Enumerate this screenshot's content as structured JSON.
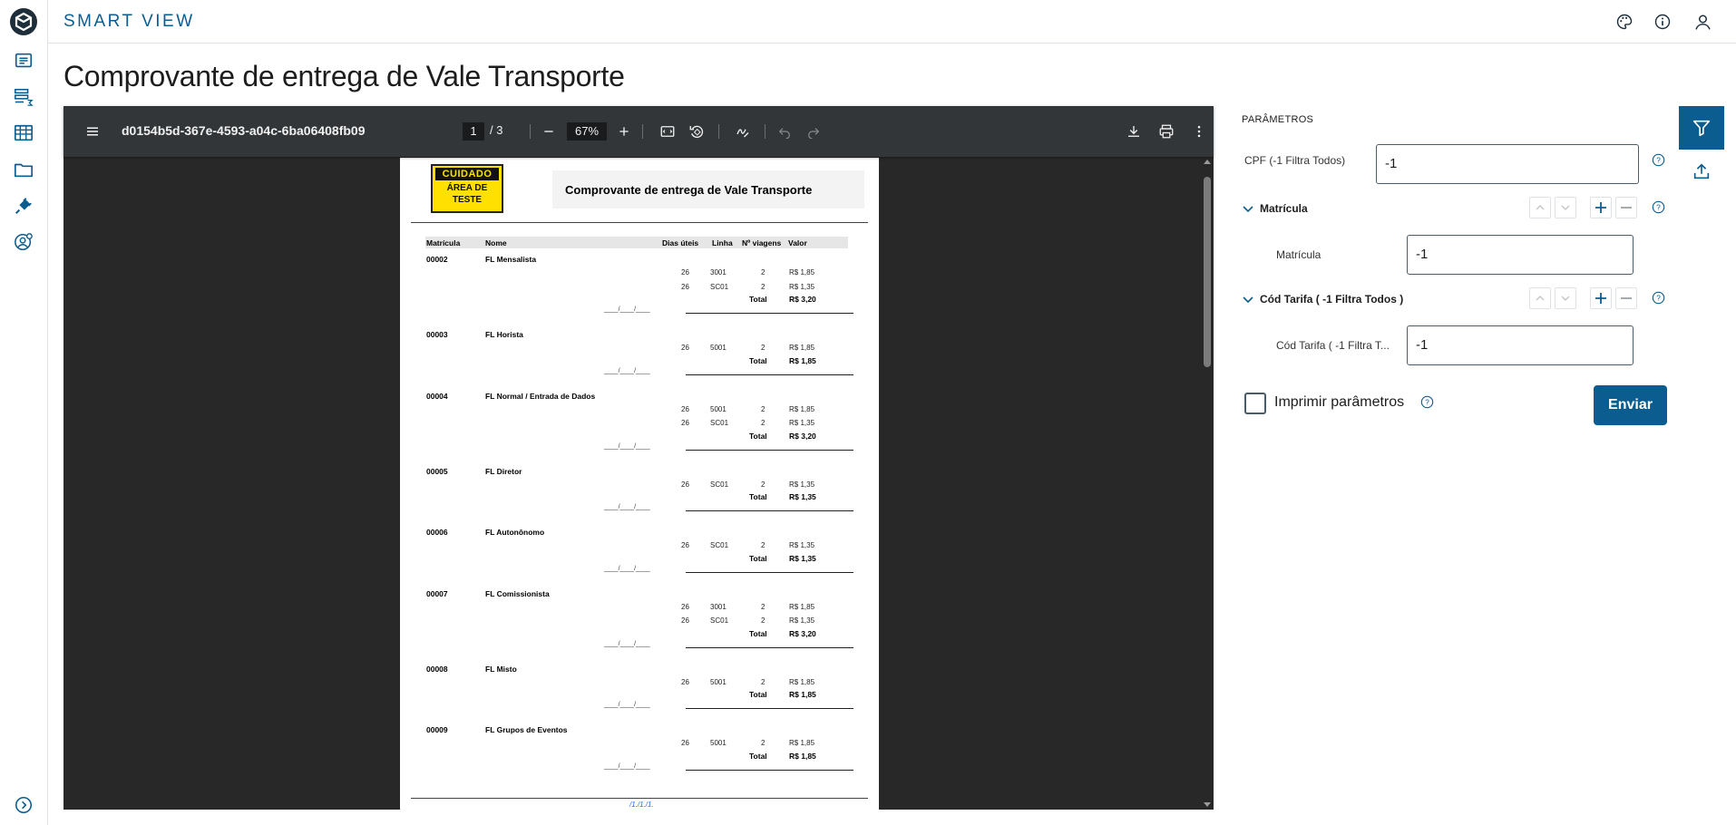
{
  "app": {
    "brand": "SMART VIEW"
  },
  "colors": {
    "accent": "#0c5d8f",
    "viewer_bg": "#282828",
    "toolbar_bg": "#323639",
    "warning_yellow": "#ffe000"
  },
  "sidebar": {
    "items": [
      {
        "icon": "report-icon"
      },
      {
        "icon": "data-table-sum-icon"
      },
      {
        "icon": "grid-table-icon"
      },
      {
        "icon": "folder-icon"
      },
      {
        "icon": "plug-icon"
      },
      {
        "icon": "user-settings-icon"
      }
    ],
    "expand_icon": "chevron-right-circle-icon"
  },
  "header": {
    "icons": [
      "palette-icon",
      "info-icon",
      "user-icon"
    ]
  },
  "page": {
    "title": "Comprovante de entrega de Vale Transporte"
  },
  "viewer": {
    "doc_name": "d0154b5d-367e-4593-a04c-6ba06408fb09",
    "current_page": "1",
    "page_sep": "/ 3",
    "zoom": "67%"
  },
  "report": {
    "warning_line1": "CUIDADO",
    "warning_line2": "ÁREA DE",
    "warning_line3": "TESTE",
    "title": "Comprovante de entrega de Vale Transporte",
    "headers": {
      "matricula": "Matrícula",
      "nome": "Nome",
      "dias": "Dias úteis",
      "linha": "Linha",
      "viagens": "Nº viagens",
      "valor": "Valor"
    },
    "sig_placeholder": "____/____/____",
    "footer": "/1./1./1.",
    "total_label": "Total",
    "employees": [
      {
        "mat": "00002",
        "name": "FL Mensalista",
        "rows": [
          [
            "26",
            "3001",
            "2",
            "R$ 1,85"
          ],
          [
            "26",
            "SC01",
            "2",
            "R$ 1,35"
          ]
        ],
        "total": "R$ 3,20"
      },
      {
        "mat": "00003",
        "name": "FL Horista",
        "rows": [
          [
            "26",
            "5001",
            "2",
            "R$ 1,85"
          ]
        ],
        "total": "R$ 1,85"
      },
      {
        "mat": "00004",
        "name": "FL Normal / Entrada de Dados",
        "rows": [
          [
            "26",
            "5001",
            "2",
            "R$ 1,85"
          ],
          [
            "26",
            "SC01",
            "2",
            "R$ 1,35"
          ]
        ],
        "total": "R$ 3,20"
      },
      {
        "mat": "00005",
        "name": "FL Diretor",
        "rows": [
          [
            "26",
            "SC01",
            "2",
            "R$ 1,35"
          ]
        ],
        "total": "R$ 1,35"
      },
      {
        "mat": "00006",
        "name": "FL Autonônomo",
        "rows": [
          [
            "26",
            "SC01",
            "2",
            "R$ 1,35"
          ]
        ],
        "total": "R$ 1,35"
      },
      {
        "mat": "00007",
        "name": "FL Comissionista",
        "rows": [
          [
            "26",
            "3001",
            "2",
            "R$ 1,85"
          ],
          [
            "26",
            "SC01",
            "2",
            "R$ 1,35"
          ]
        ],
        "total": "R$ 3,20"
      },
      {
        "mat": "00008",
        "name": "FL Misto",
        "rows": [
          [
            "26",
            "5001",
            "2",
            "R$ 1,85"
          ]
        ],
        "total": "R$ 1,85"
      },
      {
        "mat": "00009",
        "name": "FL Grupos de Eventos",
        "rows": [
          [
            "26",
            "5001",
            "2",
            "R$ 1,85"
          ]
        ],
        "total": "R$ 1,85"
      }
    ]
  },
  "params": {
    "title": "PARÂMETROS",
    "cpf_label": "CPF (-1 Filtra Todos)",
    "cpf_value": "-1",
    "group1_title": "Matrícula",
    "group1_field_label": "Matrícula",
    "group1_value": "-1",
    "group2_title": "Cód Tarifa ( -1 Filtra Todos )",
    "group2_field_label": "Cód Tarifa ( -1 Filtra T...",
    "group2_value": "-1",
    "print_label": "Imprimir parâmetros",
    "send_label": "Enviar"
  },
  "right_tools": [
    "filter-icon",
    "upload-icon"
  ]
}
